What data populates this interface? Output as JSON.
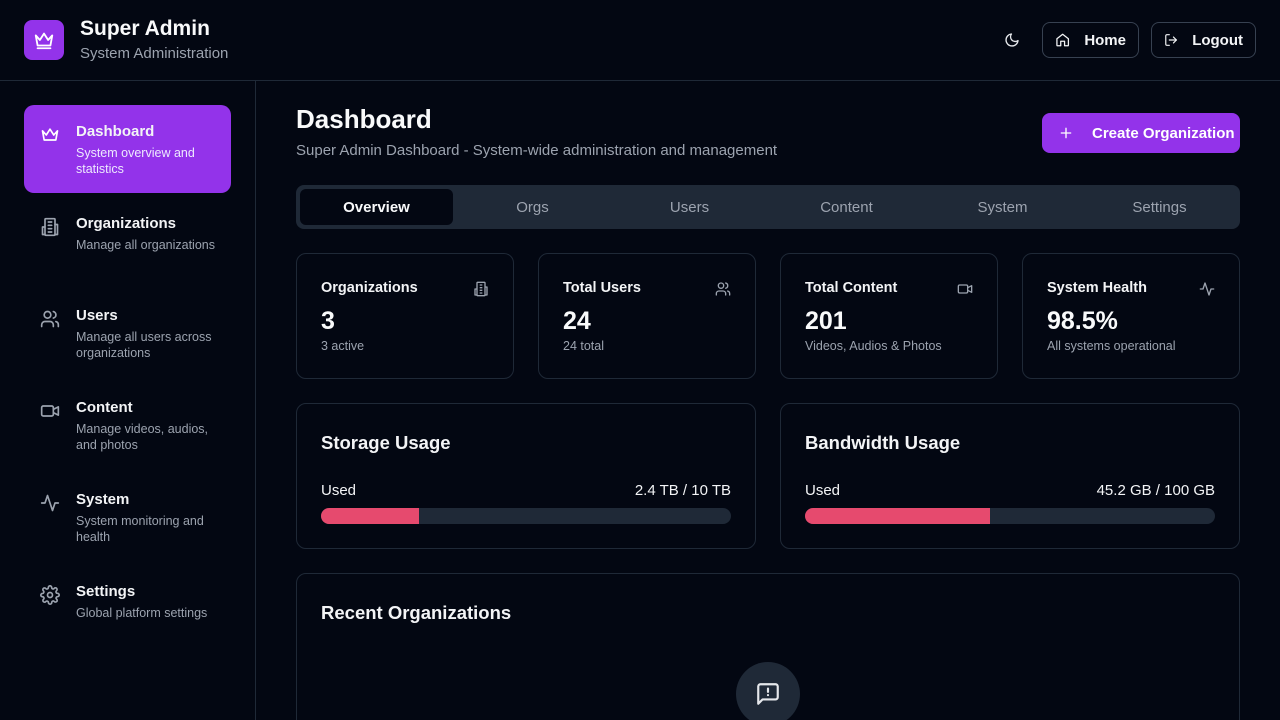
{
  "header": {
    "title": "Super Admin",
    "subtitle": "System Administration",
    "logo_icon": "crown-icon",
    "theme_icon": "moon-icon",
    "home_label": "Home",
    "logout_label": "Logout"
  },
  "sidebar": {
    "items": [
      {
        "label": "Dashboard",
        "desc": "System overview and statistics",
        "icon": "crown-icon",
        "active": true
      },
      {
        "label": "Organizations",
        "desc": "Manage all organizations",
        "icon": "building-icon"
      },
      {
        "label": "Users",
        "desc": "Manage all users across organizations",
        "icon": "users-icon"
      },
      {
        "label": "Content",
        "desc": "Manage videos, audios, and photos",
        "icon": "video-icon"
      },
      {
        "label": "System",
        "desc": "System monitoring and health",
        "icon": "activity-icon"
      },
      {
        "label": "Settings",
        "desc": "Global platform settings",
        "icon": "gear-icon"
      }
    ]
  },
  "main": {
    "title": "Dashboard",
    "subtitle": "Super Admin Dashboard - System-wide administration and management",
    "create_label": "Create Organization",
    "tabs": [
      "Overview",
      "Orgs",
      "Users",
      "Content",
      "System",
      "Settings"
    ],
    "active_tab": "Overview",
    "stats": [
      {
        "label": "Organizations",
        "value": "3",
        "sub": "3 active",
        "icon": "building-icon"
      },
      {
        "label": "Total Users",
        "value": "24",
        "sub": "24 total",
        "icon": "users-icon"
      },
      {
        "label": "Total Content",
        "value": "201",
        "sub": "Videos, Audios & Photos",
        "icon": "video-icon"
      },
      {
        "label": "System Health",
        "value": "98.5%",
        "sub": "All systems operational",
        "icon": "activity-icon"
      }
    ],
    "storage": {
      "title": "Storage Usage",
      "used_label": "Used",
      "amount": "2.4 TB / 10 TB",
      "fraction": 0.24
    },
    "bandwidth": {
      "title": "Bandwidth Usage",
      "used_label": "Used",
      "amount": "45.2 GB / 100 GB",
      "fraction": 0.452
    },
    "recent": {
      "title": "Recent Organizations",
      "empty_icon": "message-square-warning-icon"
    }
  },
  "colors": {
    "accent": "#9333ea",
    "progress": "#e64a6e",
    "background": "#030712",
    "surface": "#1f2937"
  }
}
